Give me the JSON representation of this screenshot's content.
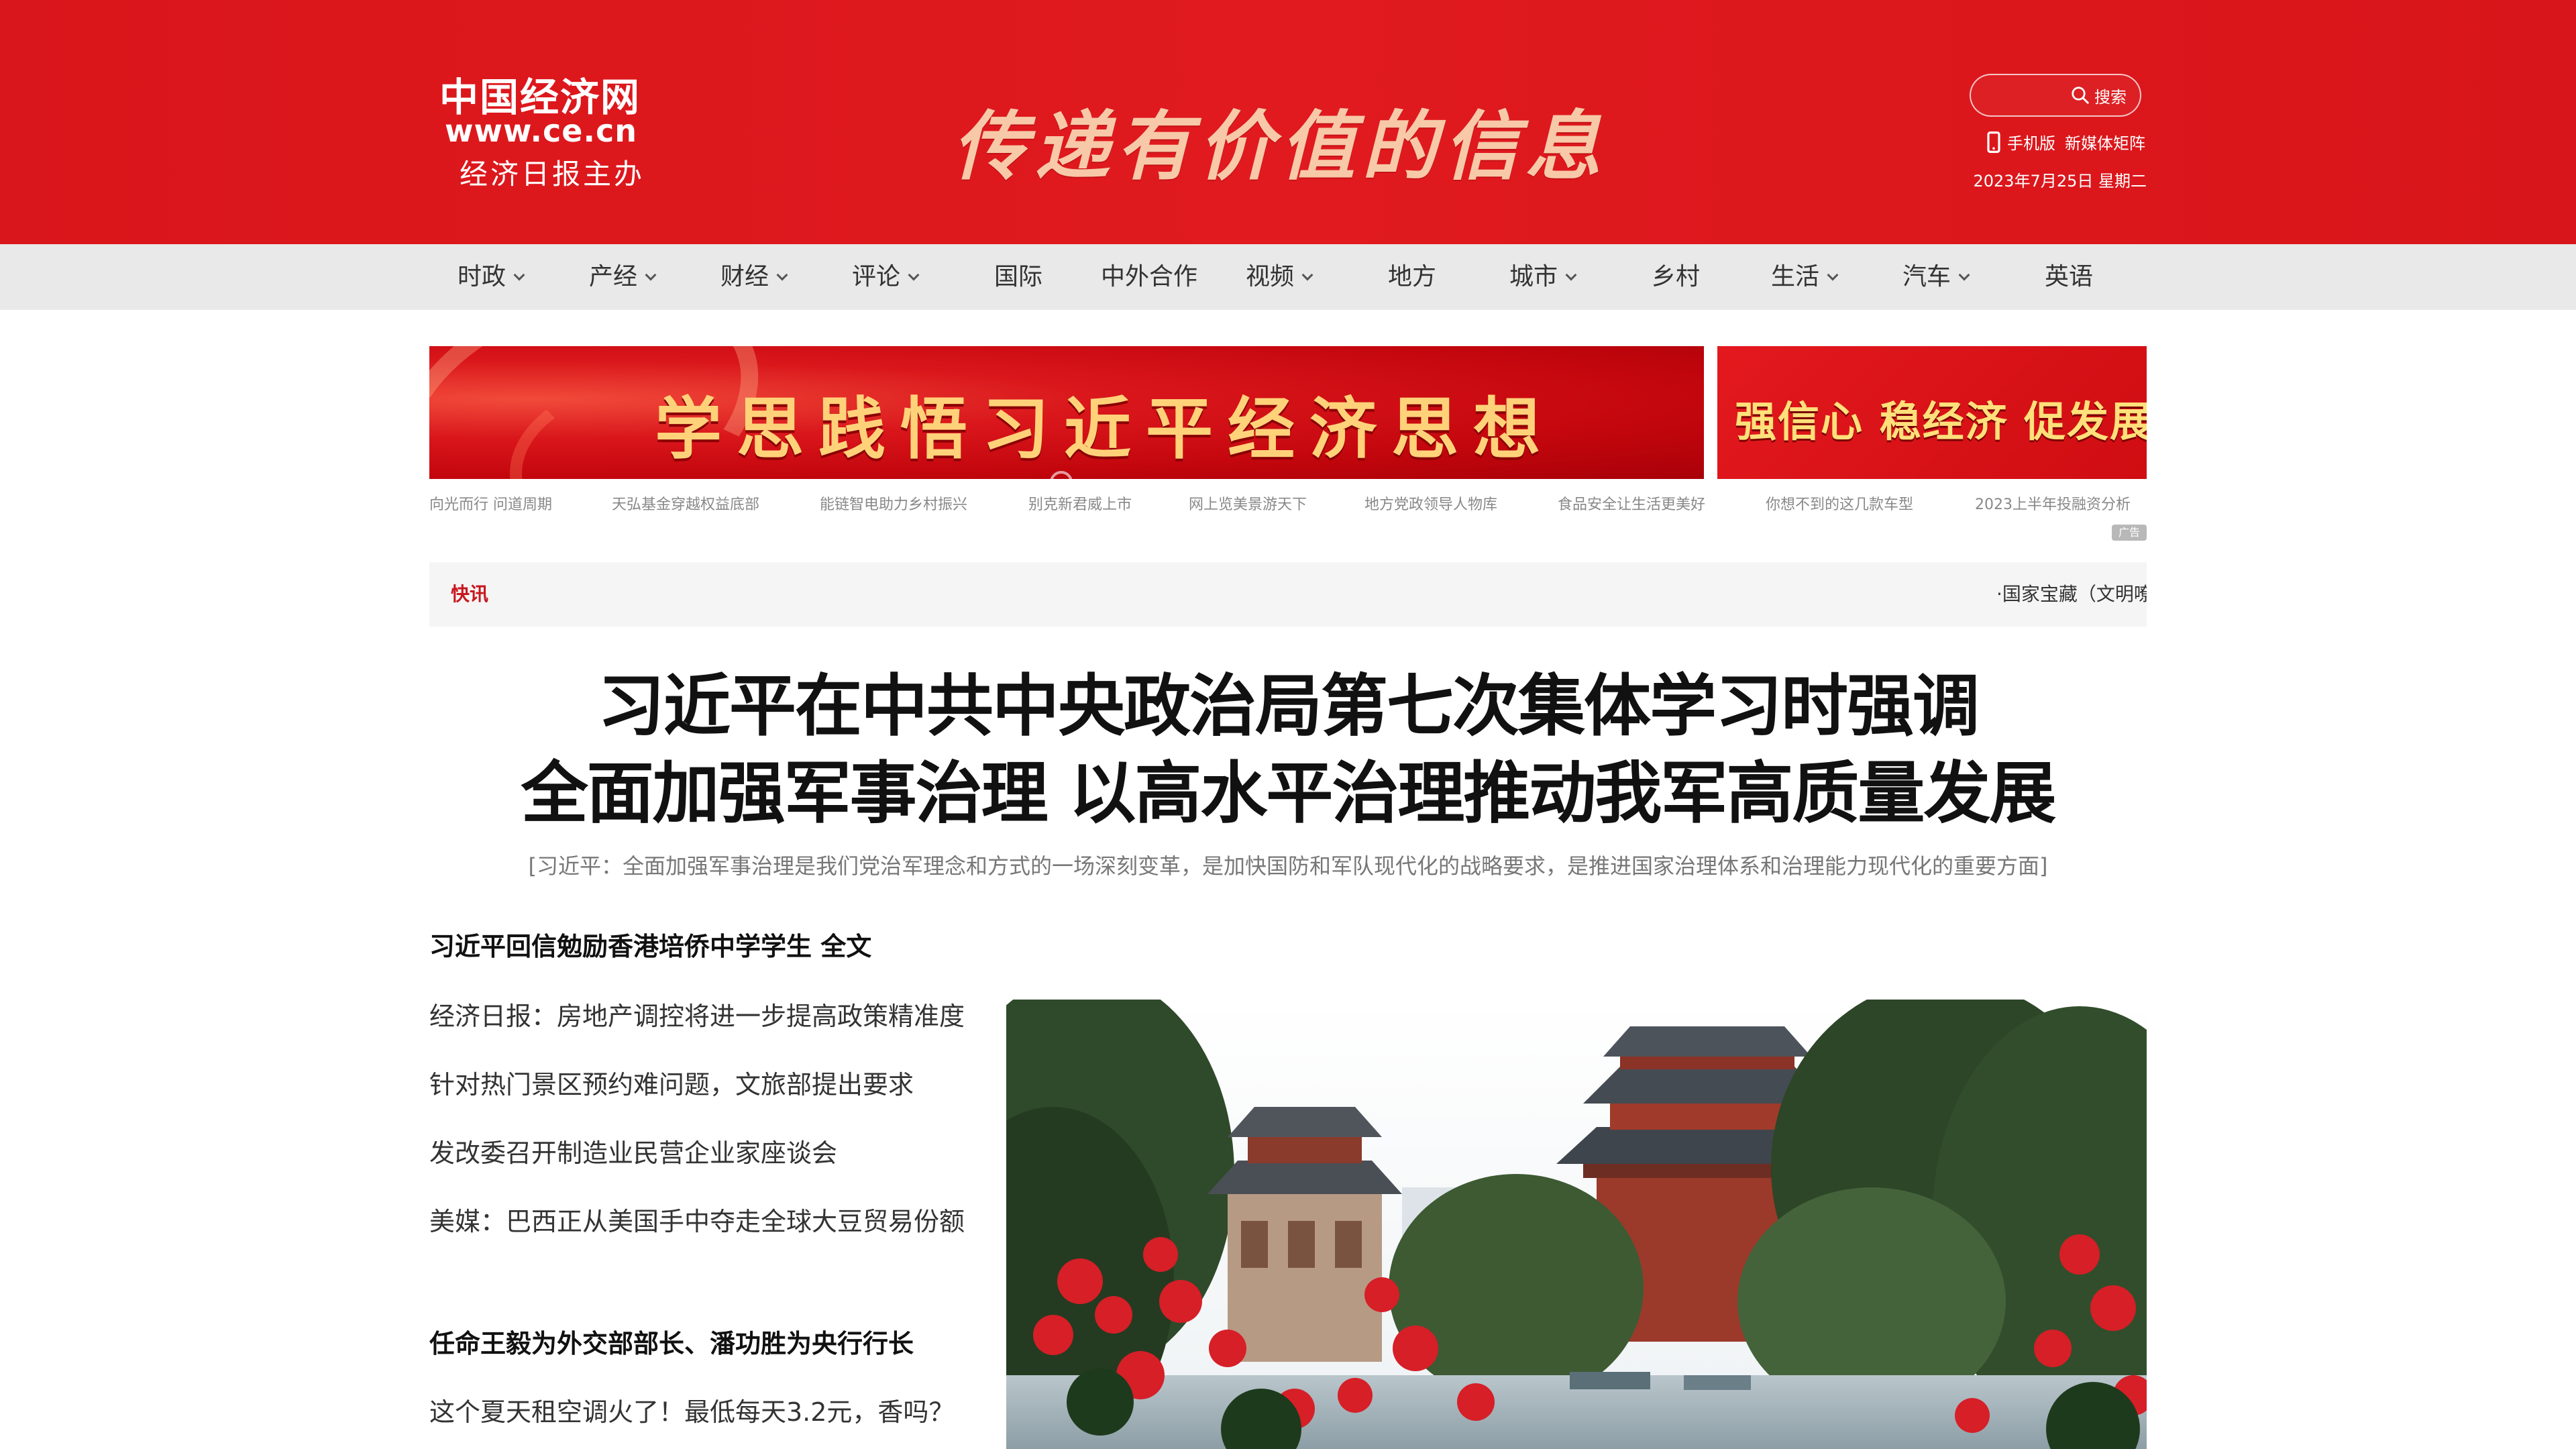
{
  "site": {
    "logo_cn": "中国经济网",
    "logo_url": "www.ce.cn",
    "logo_sponsor": "经济日报主办",
    "slogan": "传递有价值的信息"
  },
  "header_tools": {
    "search_label": "搜索",
    "mobile_label": "手机版",
    "media_matrix_label": "新媒体矩阵",
    "date": "2023年7月25日 星期二"
  },
  "nav": [
    {
      "label": "时政",
      "dropdown": true
    },
    {
      "label": "产经",
      "dropdown": true
    },
    {
      "label": "财经",
      "dropdown": true
    },
    {
      "label": "评论",
      "dropdown": true
    },
    {
      "label": "国际",
      "dropdown": false
    },
    {
      "label": "中外合作",
      "dropdown": false
    },
    {
      "label": "视频",
      "dropdown": true
    },
    {
      "label": "地方",
      "dropdown": false
    },
    {
      "label": "城市",
      "dropdown": true
    },
    {
      "label": "乡村",
      "dropdown": false
    },
    {
      "label": "生活",
      "dropdown": true
    },
    {
      "label": "汽车",
      "dropdown": true
    },
    {
      "label": "英语",
      "dropdown": false
    }
  ],
  "banners": {
    "main": "学思践悟习近平经济思想",
    "side": "强信心 稳经济 促发展"
  },
  "sublinks": [
    "向光而行 问道周期",
    "天弘基金穿越权益底部",
    "能链智电助力乡村振兴",
    "别克新君威上市",
    "网上览美景游天下",
    "地方党政领导人物库",
    "食品安全让生活更美好",
    "你想不到的这几款车型",
    "2023上半年投融资分析"
  ],
  "ad_badge": "广告",
  "flash": {
    "label": "快讯",
    "text": "·国家宝藏（文明嘹"
  },
  "headline": {
    "line1": "习近平在中共中央政治局第七次集体学习时强调",
    "line2": "全面加强军事治理 以高水平治理推动我军高质量发展",
    "summary": "[习近平：全面加强军事治理是我们党治军理念和方式的一场深刻变革，是加快国防和军队现代化的战略要求，是推进国家治理体系和治理能力现代化的重要方面]"
  },
  "news": [
    {
      "text": "习近平回信勉励香港培侨中学学生 全文",
      "bold": true
    },
    {
      "text": "经济日报：房地产调控将进一步提高政策精准度",
      "bold": false
    },
    {
      "text": "针对热门景区预约难问题，文旅部提出要求",
      "bold": false
    },
    {
      "text": "发改委召开制造业民营企业家座谈会",
      "bold": false
    },
    {
      "text": "美媒：巴西正从美国手中夺走全球大豆贸易份额",
      "bold": false
    },
    {
      "text": "任命王毅为外交部部长、潘功胜为央行行长",
      "bold": true
    },
    {
      "text": "这个夏天租空调火了！最低每天3.2元，香吗？",
      "bold": false
    }
  ],
  "colors": {
    "header_red": "#e01a1f",
    "flash_red": "#c8161d",
    "nav_bg": "#e9e9e9"
  }
}
